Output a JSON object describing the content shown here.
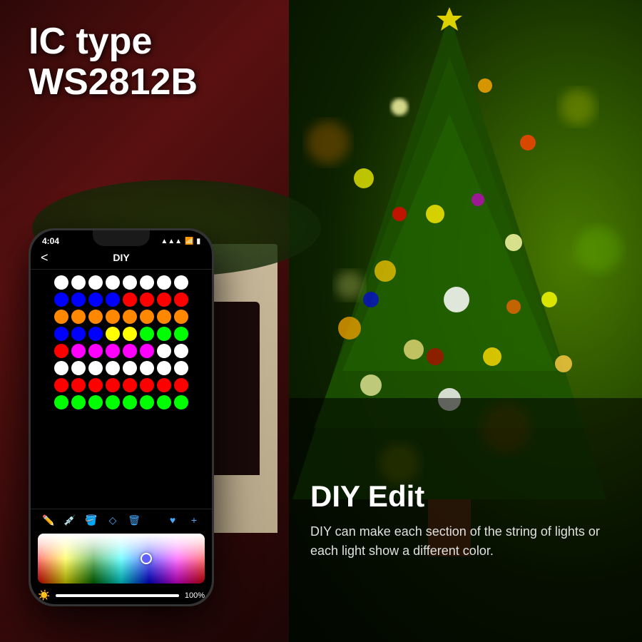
{
  "page": {
    "title": "IC type WS2812B - DIY Edit",
    "background": {
      "left_color": "#2d0808",
      "right_color": "#1a3a00"
    }
  },
  "ic_label": {
    "line1": "IC type",
    "line2": "WS2812B"
  },
  "diy_section": {
    "title": "DIY Edit",
    "description": "DIY can make each section of the string of lights or each light show a different color."
  },
  "phone": {
    "status_time": "4:04",
    "status_icons": "▲ ▲ ▲",
    "nav_title": "DIY",
    "nav_back": "<",
    "brightness_value": "100%",
    "dot_grid": [
      [
        "#ffffff",
        "#ffffff",
        "#ffffff",
        "#ffffff",
        "#ffffff",
        "#ffffff",
        "#ffffff",
        "#ffffff"
      ],
      [
        "#0000ff",
        "#0000ff",
        "#0000ff",
        "#0000ff",
        "#ff0000",
        "#ff0000",
        "#ff0000",
        "#ff0000"
      ],
      [
        "#ff8800",
        "#ff8800",
        "#ff8800",
        "#ff8800",
        "#ff8800",
        "#ff8800",
        "#ff8800",
        "#ff8800"
      ],
      [
        "#0000ff",
        "#0000ff",
        "#0000ff",
        "#ffff00",
        "#ffff00",
        "#00ff00",
        "#00ff00",
        "#00ff00"
      ],
      [
        "#ff0000",
        "#ff00ff",
        "#ff00ff",
        "#ff00ff",
        "#ff00ff",
        "#ff00ff",
        "#ffffff",
        "#ffffff"
      ],
      [
        "#ffffff",
        "#ffffff",
        "#ffffff",
        "#ffffff",
        "#ffffff",
        "#ffffff",
        "#ffffff",
        "#ffffff"
      ],
      [
        "#ff0000",
        "#ff0000",
        "#ff0000",
        "#ff0000",
        "#ff0000",
        "#ff0000",
        "#ff0000",
        "#ff0000"
      ],
      [
        "#00ff00",
        "#00ff00",
        "#00ff00",
        "#00ff00",
        "#00ff00",
        "#00ff00",
        "#00ff00",
        "#00ff00"
      ]
    ]
  }
}
